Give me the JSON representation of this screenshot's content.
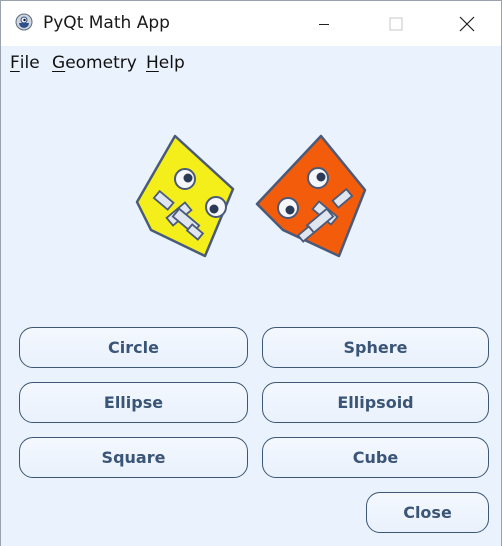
{
  "window": {
    "title": "PyQt Math App"
  },
  "menu": {
    "file": {
      "mnemonic": "F",
      "rest": "ile"
    },
    "geometry": {
      "mnemonic": "G",
      "rest": "eometry"
    },
    "help": {
      "mnemonic": "H",
      "rest": "elp"
    }
  },
  "buttons": {
    "circle": "Circle",
    "sphere": "Sphere",
    "ellipse": "Ellipse",
    "ellipsoid": "Ellipsoid",
    "square": "Square",
    "cube": "Cube",
    "close": "Close"
  },
  "colors": {
    "client_bg": "#eaf2fd",
    "button_border": "#3d5775",
    "button_text": "#3a5577",
    "logo_left": "#f4ee1a",
    "logo_right": "#f25c0a"
  },
  "icons": {
    "app": "pyqt-logo-icon",
    "minimize": "minimize-icon",
    "maximize": "maximize-icon",
    "close": "close-icon",
    "logo": "qt-robot-logo"
  }
}
